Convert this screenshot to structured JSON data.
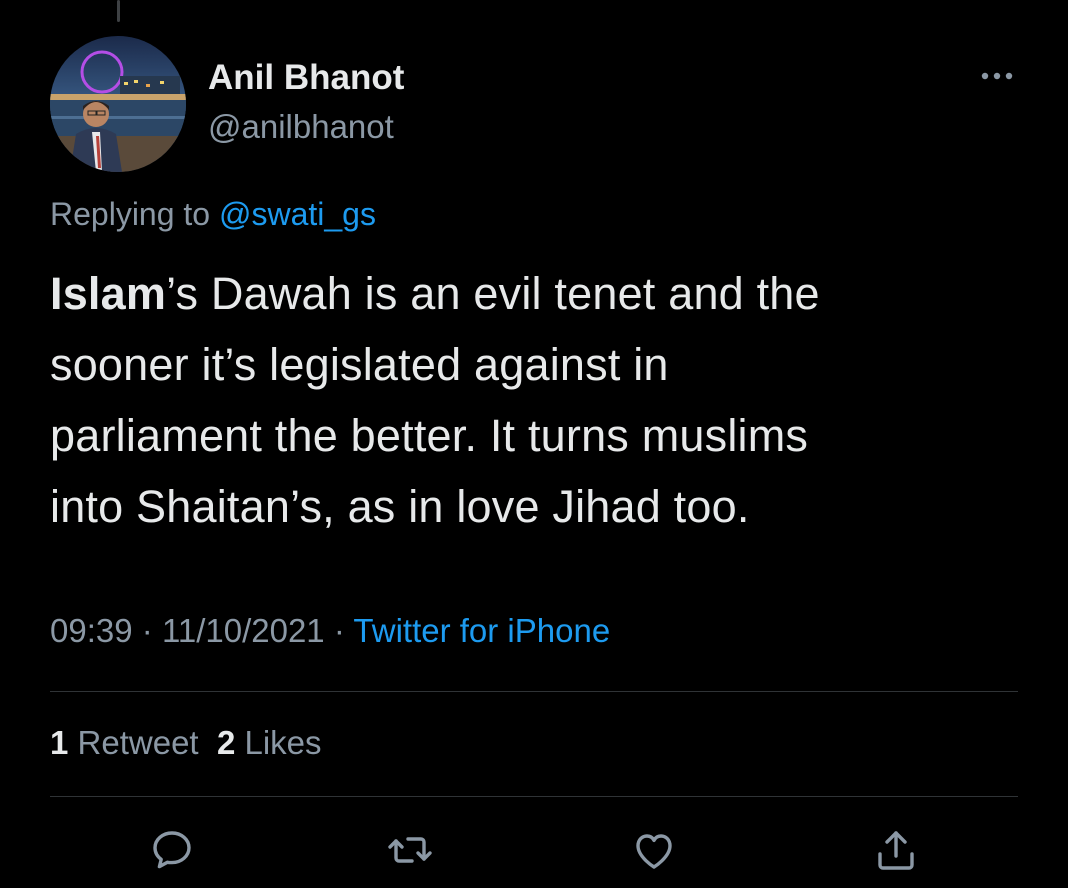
{
  "tweet": {
    "display_name": "Anil Bhanot",
    "handle": "@anilbhanot",
    "replying_prefix": "Replying to",
    "replying_to": "@swati_gs",
    "text_lines": [
      {
        "bold": "Islam",
        "rest": "’s Dawah is an evil tenet and the"
      },
      {
        "bold": "",
        "rest": "sooner it’s legislated against in"
      },
      {
        "bold": "",
        "rest": "parliament the better. It turns muslims"
      },
      {
        "bold": "",
        "rest": "into Shaitan’s, as in love Jihad too."
      }
    ],
    "time": "09:39",
    "date": "11/10/2021",
    "separator": "·",
    "source": "Twitter for iPhone"
  },
  "stats": {
    "retweets_count": "1",
    "retweets_label": "Retweet",
    "likes_count": "2",
    "likes_label": "Likes"
  },
  "actions": {
    "reply_icon": "reply-icon",
    "retweet_icon": "retweet-icon",
    "like_icon": "heart-icon",
    "share_icon": "share-icon"
  },
  "colors": {
    "background": "#000000",
    "primary_text": "#e7e9ea",
    "secondary_text": "#8b98a5",
    "accent": "#1d9bf0",
    "divider": "#2f3336"
  }
}
